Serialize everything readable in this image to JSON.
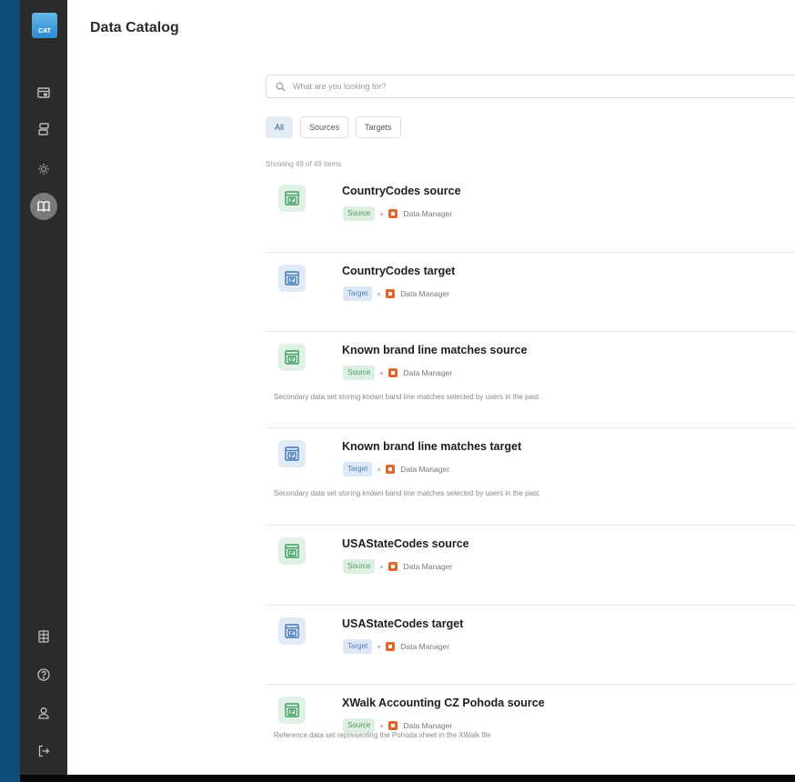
{
  "app": {
    "logo_text": "CAT"
  },
  "sidebar": {
    "items": [
      {
        "name": "catalog-nav-item",
        "icon": "stack-icon"
      },
      {
        "name": "pipelines-nav-item",
        "icon": "flow-icon"
      },
      {
        "name": "settings-nav-item",
        "icon": "gear-icon"
      },
      {
        "name": "data-catalog-nav-item",
        "icon": "book-icon",
        "active": true
      }
    ],
    "bottom_items": [
      {
        "name": "apps-nav-item",
        "icon": "grid-icon"
      },
      {
        "name": "help-nav-item",
        "icon": "help-icon"
      },
      {
        "name": "profile-nav-item",
        "icon": "user-icon"
      },
      {
        "name": "logout-nav-item",
        "icon": "logout-icon"
      }
    ]
  },
  "header": {
    "title": "Data Catalog"
  },
  "search": {
    "placeholder": "What are you looking for?"
  },
  "filters": {
    "all": "All",
    "sources": "Sources",
    "targets": "Targets",
    "active": "All"
  },
  "showing": "Showing 49 of 49 items",
  "items": [
    {
      "title": "CountryCodes source",
      "type": "Source",
      "owner": "Data Manager",
      "description": ""
    },
    {
      "title": "CountryCodes target",
      "type": "Target",
      "owner": "Data Manager",
      "description": ""
    },
    {
      "title": "Known brand line matches source",
      "type": "Source",
      "owner": "Data Manager",
      "description": "Secondary data set storing known band line matches selected by users in the past."
    },
    {
      "title": "Known brand line matches target",
      "type": "Target",
      "owner": "Data Manager",
      "description": "Secondary data set storing known band line matches selected by users in the past."
    },
    {
      "title": "USAStateCodes source",
      "type": "Source",
      "owner": "Data Manager",
      "description": ""
    },
    {
      "title": "USAStateCodes target",
      "type": "Target",
      "owner": "Data Manager",
      "description": ""
    },
    {
      "title": "XWalk Accounting CZ Pohoda source",
      "type": "Source",
      "owner": "Data Manager",
      "description": "Reference data set representing the Pohoda sheet in the XWalk file"
    }
  ],
  "colors": {
    "source": "#4f9a63",
    "target": "#4f7fb8",
    "sidebar": "#2b2b2b",
    "owner_icon": "#e2662c"
  }
}
